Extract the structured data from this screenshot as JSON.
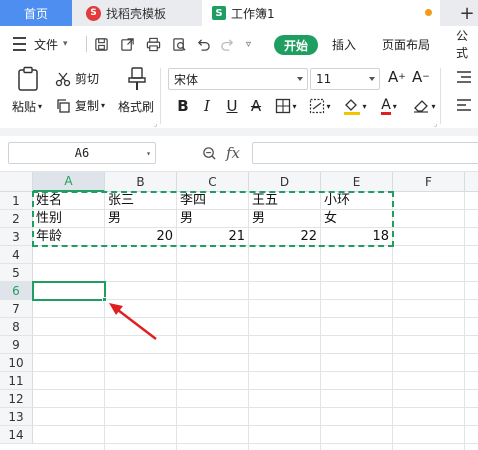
{
  "tabs": {
    "home": "首页",
    "template": "找稻壳模板",
    "template_logo": "S",
    "doc": "工作簿1",
    "doc_logo": "S"
  },
  "menu": {
    "file": "文件",
    "start": "开始",
    "insert": "插入",
    "page_layout": "页面布局",
    "formula": "公式"
  },
  "ribbon": {
    "paste": "粘贴",
    "cut": "剪切",
    "copy": "复制",
    "format_painter": "格式刷",
    "font_name": "宋体",
    "font_size": "11",
    "bold": "B",
    "italic": "I",
    "underline": "U",
    "strike": "A",
    "font_color": "A",
    "grow": "A",
    "shrink": "A"
  },
  "formula_bar": {
    "cell_ref": "A6",
    "fx": "fx",
    "value": ""
  },
  "sheet": {
    "columns": [
      "A",
      "B",
      "C",
      "D",
      "E",
      "F"
    ],
    "rows": [
      "1",
      "2",
      "3",
      "4",
      "5",
      "6",
      "7",
      "8",
      "9",
      "10",
      "11",
      "12",
      "13",
      "14"
    ],
    "cells": {
      "A1": "姓名",
      "B1": "张三",
      "C1": "李四",
      "D1": "王五",
      "E1": "小环",
      "A2": "性别",
      "B2": "男",
      "C2": "男",
      "D2": "男",
      "E2": "女",
      "A3": "年龄",
      "B3": "20",
      "C3": "21",
      "D3": "22",
      "E3": "18"
    },
    "selected_cell": "A6",
    "copy_range": "A1:E3"
  },
  "colors": {
    "accent": "#1f9e62",
    "home_tab": "#4d8ef0",
    "arrow": "#e02020"
  }
}
